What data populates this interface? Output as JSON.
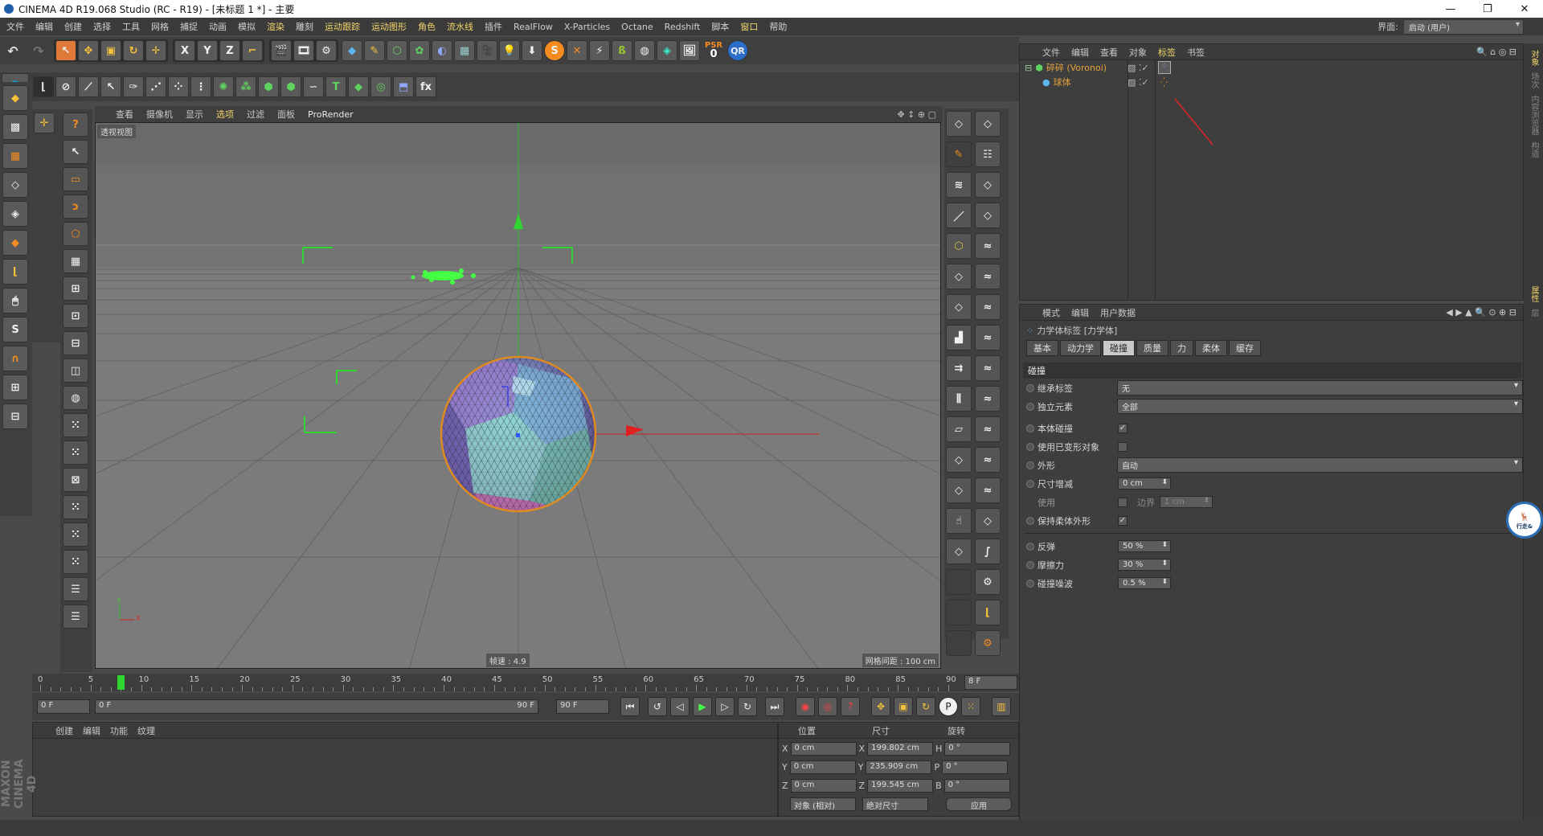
{
  "app": {
    "title": "CINEMA 4D R19.068 Studio (RC - R19) - [未标题 1 *] - 主要",
    "window_buttons": [
      "—",
      "❐",
      "✕"
    ]
  },
  "menu": {
    "items": [
      "文件",
      "编辑",
      "创建",
      "选择",
      "工具",
      "网格",
      "捕捉",
      "动画",
      "模拟",
      "渲染",
      "雕刻",
      "运动跟踪",
      "运动图形",
      "角色",
      "流水线",
      "插件",
      "RealFlow",
      "X-Particles",
      "Octane",
      "Redshift",
      "脚本",
      "窗口",
      "帮助"
    ],
    "layout_label": "界面:",
    "layout_value": "启动 (用户)"
  },
  "toolbar": {
    "psr_label": "PSR",
    "psr_value": "0",
    "qr_label": "QR",
    "fx_label": "fx"
  },
  "viewport": {
    "menu": [
      "查看",
      "摄像机",
      "显示",
      "选项",
      "过滤",
      "面板",
      "ProRender"
    ],
    "view_label": "透视视图",
    "speed_label": "帧速 : 4.9",
    "grid_label": "网格间距 : 100 cm",
    "axis_y": "Y",
    "axis_x": "X"
  },
  "object_manager": {
    "tabs": [
      "文件",
      "编辑",
      "查看",
      "对象",
      "标签",
      "书签"
    ],
    "objects": [
      {
        "name": "碎碎 (Voronoi)",
        "depth": 0
      },
      {
        "name": "球体",
        "depth": 1
      }
    ]
  },
  "attribute_manager": {
    "tabs": [
      "模式",
      "编辑",
      "用户数据"
    ],
    "tag_title": "力学体标签 [力学体]",
    "subtabs": [
      "基本",
      "动力学",
      "碰撞",
      "质量",
      "力",
      "柔体",
      "缓存"
    ],
    "active_subtab": "碰撞",
    "section": "碰撞",
    "rows": {
      "inherit_label": "继承标签",
      "inherit_value": "无",
      "standalone_label": "独立元素",
      "standalone_value": "全部",
      "self_collision_label": "本体碰撞",
      "self_collision_checked": "✓",
      "use_deformed_label": "使用已变形对象",
      "shape_label": "外形",
      "shape_value": "自动",
      "size_inc_label": "尺寸增减",
      "size_inc_value": "0 cm",
      "use_label": "使用",
      "border_label": "边界",
      "border_value": "1 cm",
      "keep_soft_label": "保持柔体外形",
      "keep_soft_checked": "✓",
      "bounce_label": "反弹",
      "bounce_value": "50 %",
      "friction_label": "摩擦力",
      "friction_value": "30 %",
      "noise_label": "碰撞噪波",
      "noise_value": "0.5 %"
    }
  },
  "timeline": {
    "ticks": [
      "0",
      "5",
      "8",
      "10",
      "15",
      "20",
      "25",
      "30",
      "35",
      "40",
      "45",
      "50",
      "55",
      "60",
      "65",
      "70",
      "75",
      "80",
      "85",
      "90"
    ],
    "current_frame": 8,
    "end_label": "8 F",
    "start_field": "0 F",
    "range_start": "0 F",
    "range_end": "90 F",
    "end_field": "90 F"
  },
  "material_manager": {
    "menu": [
      "创建",
      "编辑",
      "功能",
      "纹理"
    ]
  },
  "coordinates": {
    "headers": [
      "位置",
      "尺寸",
      "旋转"
    ],
    "rows": [
      {
        "axis": "X",
        "pos": "0 cm",
        "saxis": "X",
        "size": "199.802 cm",
        "raxis": "H",
        "rot": "0 °"
      },
      {
        "axis": "Y",
        "pos": "0 cm",
        "saxis": "Y",
        "size": "235.909 cm",
        "raxis": "P",
        "rot": "0 °"
      },
      {
        "axis": "Z",
        "pos": "0 cm",
        "saxis": "Z",
        "size": "199.545 cm",
        "raxis": "B",
        "rot": "0 °"
      }
    ],
    "mode1": "对象 (相对)",
    "mode2": "绝对尺寸",
    "apply": "应用"
  },
  "brand": "MAXON CINEMA 4D",
  "right_strip": [
    "对象",
    "场次",
    "内容浏览器",
    "构造",
    "属性",
    "层"
  ],
  "badge": "行走&"
}
